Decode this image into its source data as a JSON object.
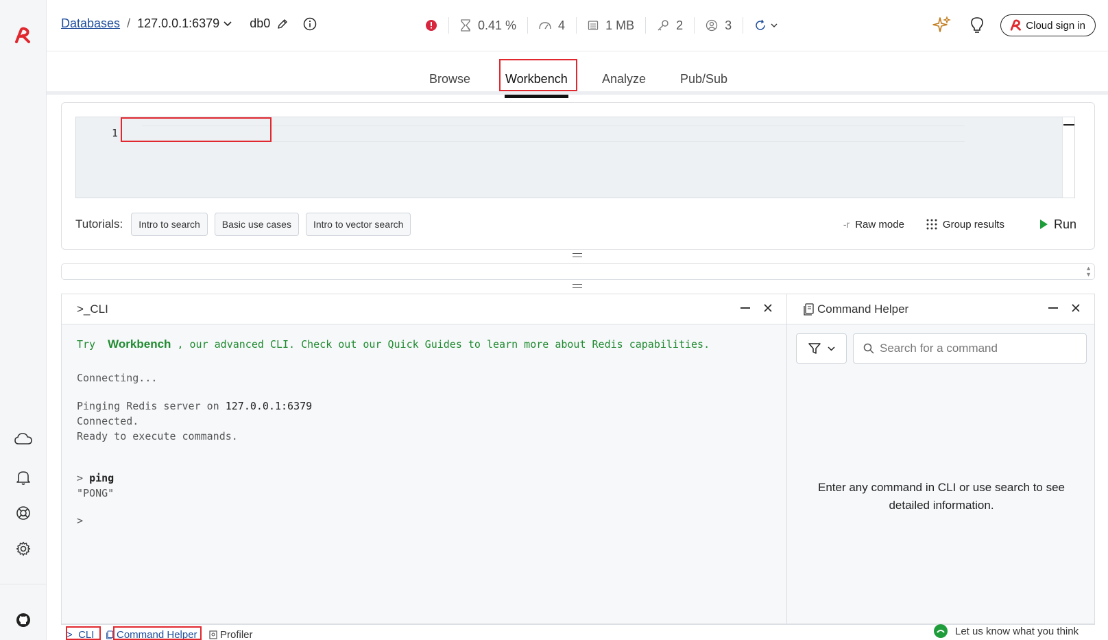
{
  "header": {
    "breadcrumb_root": "Databases",
    "breadcrumb_sep": "/",
    "endpoint": "127.0.0.1:6379",
    "db_name": "db0",
    "stats": {
      "cpu": "0.41 %",
      "ops": "4",
      "memory": "1 MB",
      "keys": "2",
      "clients": "3"
    },
    "cloud_sign_in": "Cloud sign in"
  },
  "tabs": [
    "Browse",
    "Workbench",
    "Analyze",
    "Pub/Sub"
  ],
  "active_tab": "Workbench",
  "editor": {
    "line_number": "1",
    "tutorials_label": "Tutorials:",
    "tutorials": [
      "Intro to search",
      "Basic use cases",
      "Intro to vector search"
    ],
    "raw_mode_prefix": "-r",
    "raw_mode": "Raw mode",
    "group_results": "Group results",
    "run": "Run"
  },
  "cli": {
    "title": ">_CLI",
    "intro_try": "Try",
    "intro_workbench": "Workbench",
    "intro_rest": ", our advanced CLI. Check out our Quick Guides to learn more about Redis capabilities.",
    "connecting": "Connecting...",
    "pinging_prefix": "Pinging Redis server on ",
    "pinging_host": "127.0.0.1:6379",
    "connected": "Connected.",
    "ready": "Ready to execute commands.",
    "prompt": ">",
    "command": "ping",
    "response": "\"PONG\"",
    "empty_prompt": ">"
  },
  "helper": {
    "title": "Command Helper",
    "search_placeholder": "Search for a command",
    "empty_text": "Enter any command in CLI or use search to see detailed information."
  },
  "bottombar": {
    "cli": ">_CLI",
    "helper": "Command Helper",
    "profiler": "Profiler",
    "feedback": "Let us know what you think"
  },
  "colors": {
    "brand_red": "#e0282e",
    "link_blue": "#1f4e9c",
    "cli_green": "#1f8a2f",
    "run_green": "#1f9d3a",
    "alert_red": "#d7263d"
  }
}
